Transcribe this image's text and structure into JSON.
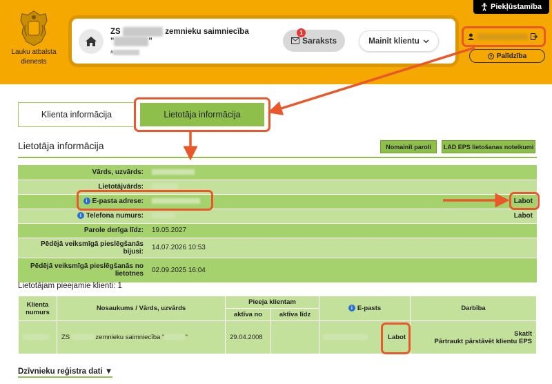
{
  "accessibility": {
    "label": "Piekļūstamība"
  },
  "logo": {
    "text_line1": "Lauku atbalsta",
    "text_line2": "dienests"
  },
  "client": {
    "prefix": "ZS",
    "name_suffix": "zemnieku saimniecība",
    "code_prefix": "#"
  },
  "header": {
    "saraksts_label": "Saraksts",
    "saraksts_badge": "1",
    "mainit_label": "Mainīt klientu",
    "palidziba_label": "Palīdzība"
  },
  "tabs": {
    "klienta": "Klienta informācija",
    "lietotaja": "Lietotāja informācija"
  },
  "section": {
    "title": "Lietotāja informācija",
    "nomainit_paroli": "Nomainīt paroli",
    "noteikumi": "LAD EPS lietošanas noteikumi"
  },
  "user_info": {
    "rows": [
      {
        "label": "Vārds, uzvārds:",
        "value": ""
      },
      {
        "label": "Lietotājvārds:",
        "value": ""
      },
      {
        "label": "E-pasta adrese:",
        "value": "",
        "action": "Labot"
      },
      {
        "label": "Telefona numurs:",
        "value": "",
        "action": "Labot"
      },
      {
        "label": "Parole derīga līdz:",
        "value": "19.05.2027"
      },
      {
        "label": "Pēdējā veiksmīgā pieslēgšanās bijusi:",
        "value": "14.07.2026 10:53"
      },
      {
        "label": "Pēdējā veiksmīgā pieslēgšanās no lietotnes",
        "value": "02.09.2025 16:04"
      }
    ]
  },
  "clients": {
    "title": "Lietotājam pieejamie klienti: 1",
    "headers": {
      "klienta_numurs": "Klienta numurs",
      "nosaukums": "Nosaukums / Vārds, uzvārds",
      "pieeja": "Pieeja klientam",
      "aktiva_no": "aktīva no",
      "aktiva_lidz": "aktīva līdz",
      "epasts": "E-pasts",
      "darbiba": "Darbība"
    },
    "row": {
      "name_prefix": "ZS",
      "name_mid": "zemnieku saimniecība \"",
      "name_end": "\"",
      "aktiva_no": "29.04.2008",
      "aktiva_lidz": "",
      "labot": "Labot",
      "skatit": "Skatīt",
      "partraukt": "Pārtraukt pārstāvēt klientu EPS"
    }
  },
  "footer": {
    "dz_link": "Dzīvnieku reģistra dati ▼"
  },
  "colors": {
    "header": "#f5a800",
    "green": "#8ebf4a",
    "highlight": "#e8582a"
  }
}
